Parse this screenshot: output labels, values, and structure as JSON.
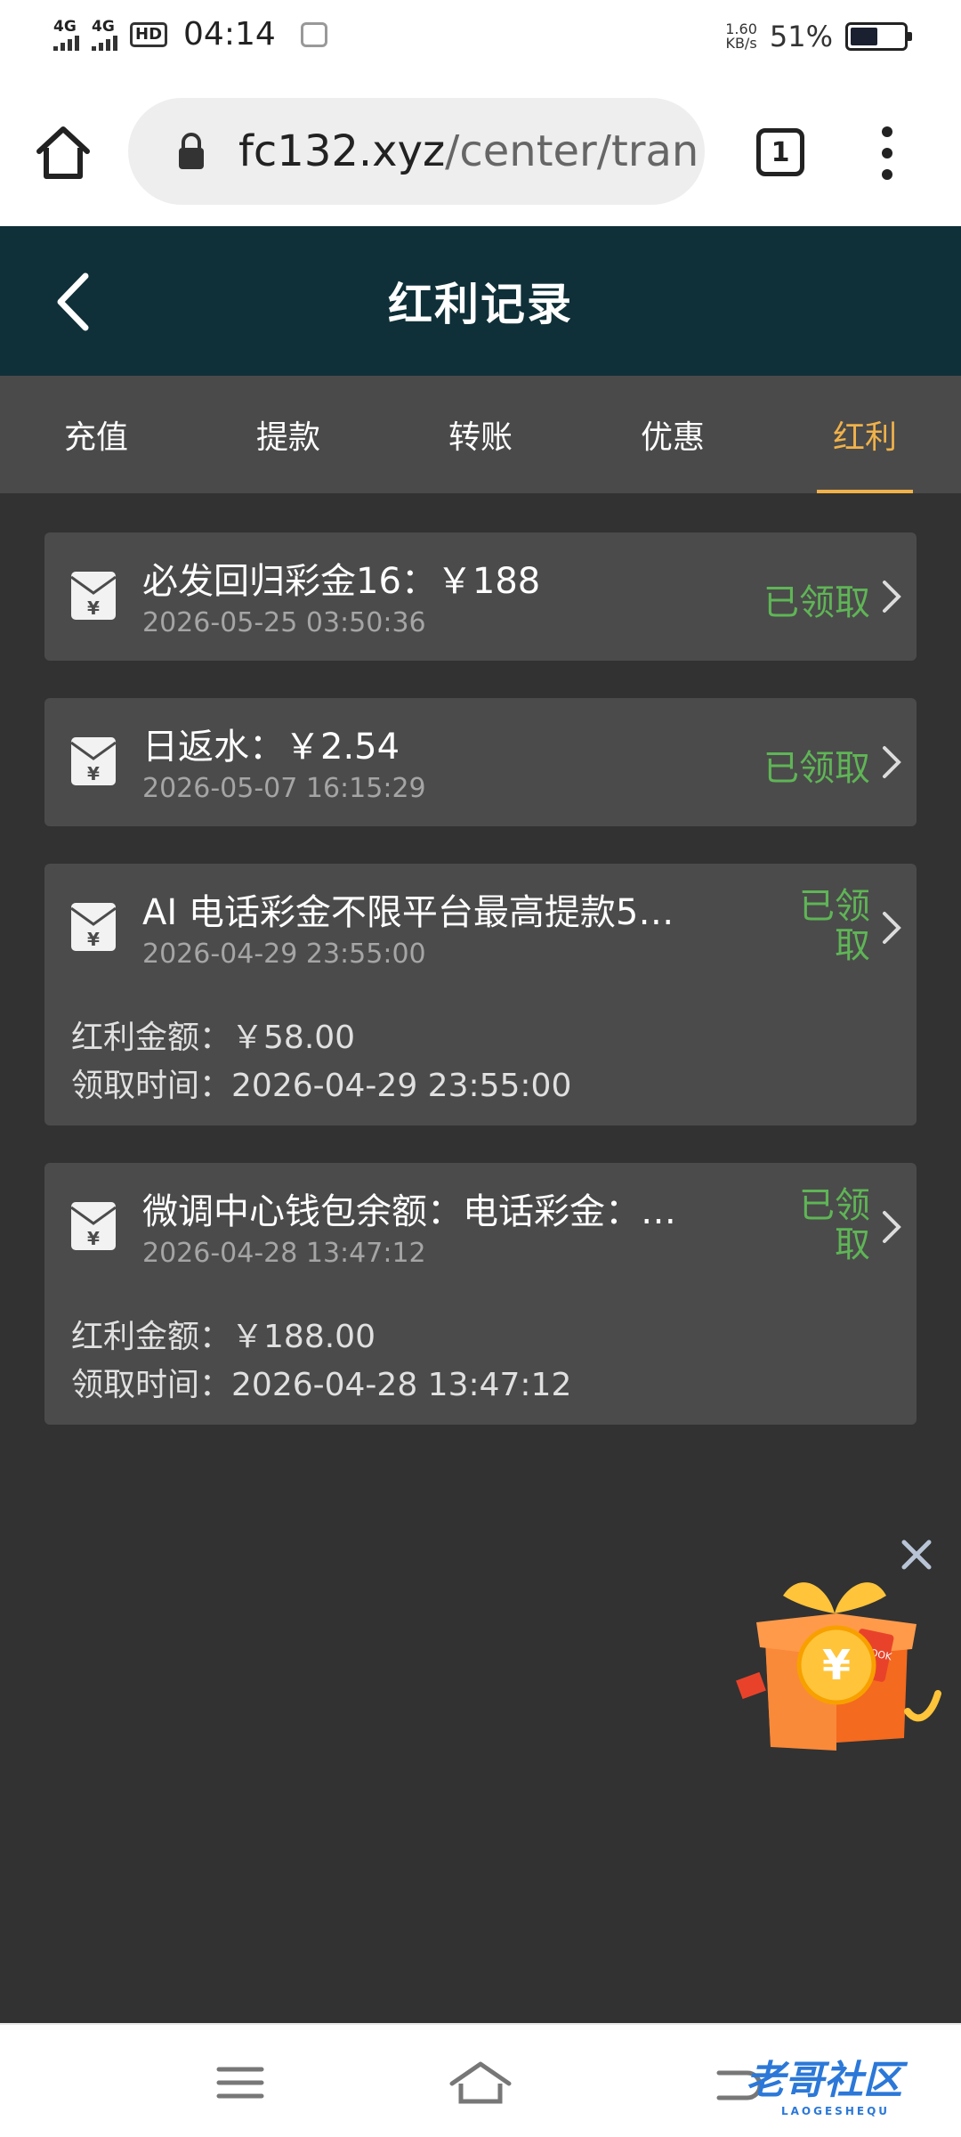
{
  "status_bar": {
    "net1": "4G",
    "net2": "4G",
    "hd": "HD",
    "time": "04:14",
    "speed_value": "1.60",
    "speed_unit": "KB/s",
    "battery_pct": "51%"
  },
  "browser": {
    "url_host": "fc132.xyz",
    "url_path": "/center/tran",
    "tab_count": "1"
  },
  "header": {
    "title": "红利记录"
  },
  "tabs": [
    {
      "label": "充值",
      "active": false
    },
    {
      "label": "提款",
      "active": false
    },
    {
      "label": "转账",
      "active": false
    },
    {
      "label": "优惠",
      "active": false
    },
    {
      "label": "红利",
      "active": true
    }
  ],
  "records": [
    {
      "title": "必发回归彩金16：￥188",
      "time": "2026-05-25 03:50:36",
      "status": "已领取"
    },
    {
      "title": "日返水：￥2.54",
      "time": "2026-05-07 16:15:29",
      "status": "已领取"
    },
    {
      "title": "AI 电话彩金不限平台最高提款50…",
      "time": "2026-04-29 23:55:00",
      "status": "已领取",
      "amount_label": "红利金额：",
      "amount": "￥58.00",
      "claim_label": "领取时间：",
      "claim_time": "2026-04-29 23:55:00"
    },
    {
      "title": "微调中心钱包余额：电话彩金：…",
      "time": "2026-04-28 13:47:12",
      "status": "已领取",
      "amount_label": "红利金额：",
      "amount": "￥188.00",
      "claim_label": "领取时间：",
      "claim_time": "2026-04-28 13:47:12"
    }
  ],
  "promo": {
    "box_label": "BOOK",
    "coin_symbol": "¥"
  },
  "watermark": {
    "text": "老哥社区",
    "sub": "LAOGESHEQU"
  },
  "colors": {
    "header_bg": "#0f3038",
    "page_bg": "#323232",
    "card_bg": "#4b4b4b",
    "tab_bar_bg": "#4a4a4a",
    "accent_active_tab": "#f0b24a",
    "status_green": "#5fb556"
  }
}
